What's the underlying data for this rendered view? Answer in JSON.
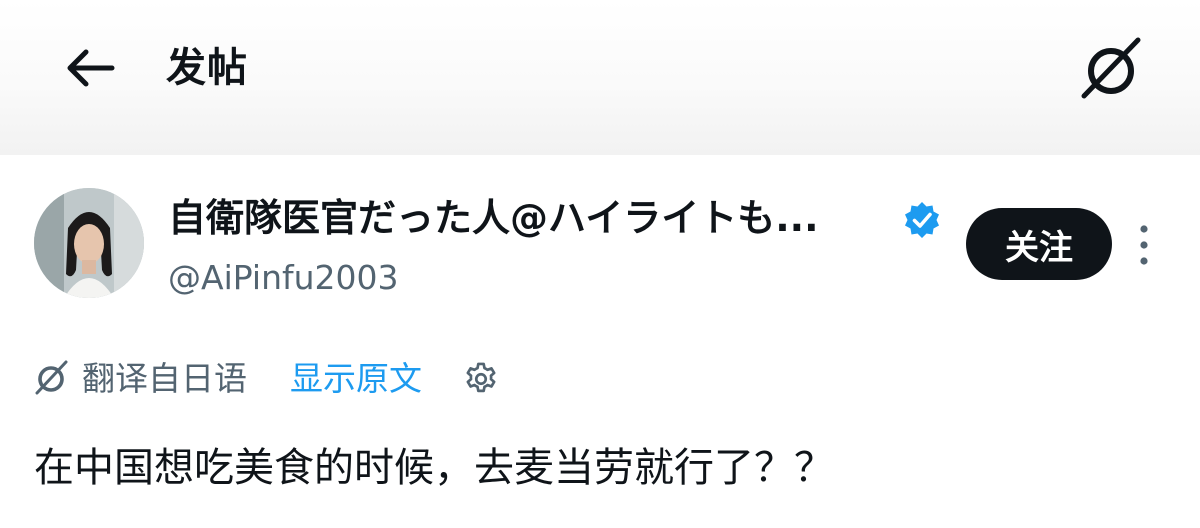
{
  "header": {
    "title": "发帖",
    "back_icon": "arrow-left-icon",
    "grok_icon": "grok-icon"
  },
  "author": {
    "name": "自衛隊医官だった人@ハイライトも...",
    "handle": "@AiPinfu2003",
    "verified": true,
    "verified_color": "#1d9bf0",
    "follow_label": "关注",
    "more_icon": "more-vertical-icon"
  },
  "translation": {
    "label": "翻译自日语",
    "show_original": "显示原文",
    "accent": "#1d9bf0"
  },
  "post": {
    "text": "在中国想吃美食的时候，去麦当劳就行了？？"
  }
}
